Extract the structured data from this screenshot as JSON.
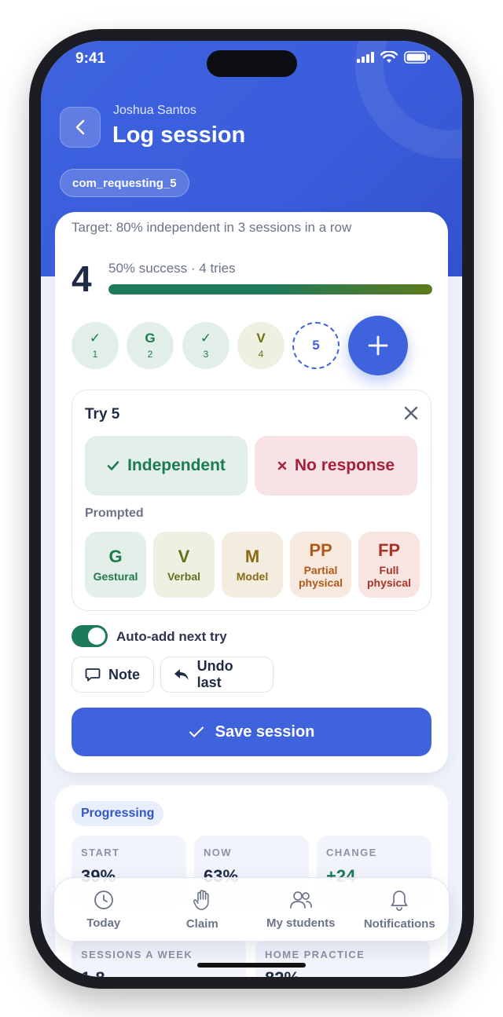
{
  "status_bar": {
    "time": "9:41"
  },
  "header": {
    "student_name": "Joshua Santos",
    "title": "Log session",
    "goal_chip": "com_requesting_5"
  },
  "session": {
    "target_text": "Target: 80% independent in 3 sessions in a row",
    "count": "4",
    "success_text": "50% success · 4 tries",
    "success_fraction": 0.5,
    "tries": [
      {
        "symbol": "✓",
        "number": "1",
        "kind": "independent"
      },
      {
        "symbol": "G",
        "number": "2",
        "kind": "gestural"
      },
      {
        "symbol": "✓",
        "number": "3",
        "kind": "independent"
      },
      {
        "symbol": "V",
        "number": "4",
        "kind": "verbal"
      },
      {
        "symbol": "5",
        "number": "",
        "kind": "pending"
      }
    ]
  },
  "try_panel": {
    "title": "Try 5",
    "independent_label": "Independent",
    "no_response_label": "No response",
    "prompted_label": "Prompted",
    "prompts": [
      {
        "abbr": "G",
        "label": "Gestural"
      },
      {
        "abbr": "V",
        "label": "Verbal"
      },
      {
        "abbr": "M",
        "label": "Model"
      },
      {
        "abbr": "PP",
        "label": "Partial physical"
      },
      {
        "abbr": "FP",
        "label": "Full physical"
      }
    ]
  },
  "controls": {
    "auto_add_label": "Auto-add next try",
    "auto_add_on": true,
    "note_label": "Note",
    "undo_label": "Undo last",
    "save_label": "Save session"
  },
  "progress_card": {
    "badge": "Progressing",
    "stats": [
      {
        "key": "START",
        "value": "39%"
      },
      {
        "key": "NOW",
        "value": "63%"
      },
      {
        "key": "CHANGE",
        "value": "+24"
      }
    ],
    "stats2": [
      {
        "key": "SESSIONS A WEEK",
        "value": "1.8"
      },
      {
        "key": "HOME PRACTICE",
        "value": "82%"
      }
    ]
  },
  "tabbar": {
    "tabs": [
      {
        "label": "Today",
        "icon": "clock-icon"
      },
      {
        "label": "Claim",
        "icon": "hand-icon"
      },
      {
        "label": "My students",
        "icon": "users-icon"
      },
      {
        "label": "Notifications",
        "icon": "bell-icon"
      }
    ]
  },
  "colors": {
    "primary": "#3f63dd",
    "independent": "#1c7a55",
    "no_response": "#a5213a"
  }
}
